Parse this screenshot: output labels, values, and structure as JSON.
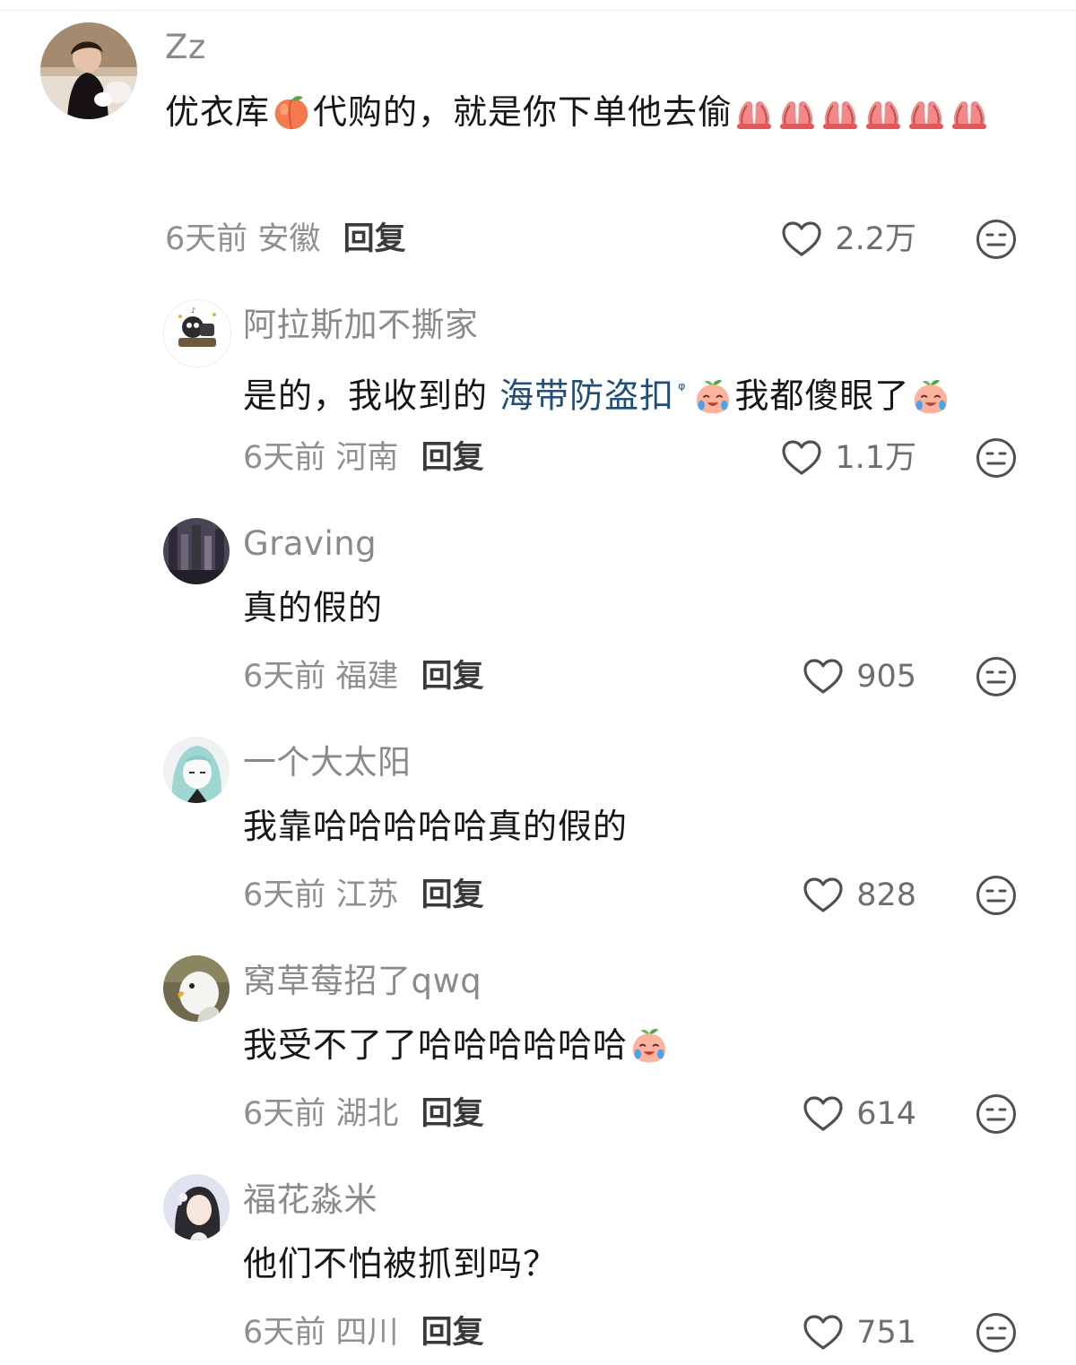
{
  "comments": [
    {
      "user": "Zz",
      "text_parts": [
        "优衣库",
        "代购的，就是你下单他去偷"
      ],
      "time": "6天前",
      "location": "安徽",
      "reply_label": "回复",
      "likes": "2.2万",
      "emoji_names": [
        "peach-emoji",
        "pray-emoji"
      ]
    },
    {
      "user": "阿拉斯加不撕家",
      "text_parts": [
        "是的，我收到的 ",
        "海带防盗扣",
        "我都傻眼了"
      ],
      "search_glyph": "ᵠ",
      "time": "6天前",
      "location": "河南",
      "reply_label": "回复",
      "likes": "1.1万",
      "emoji_names": [
        "crying-peach-emoji"
      ]
    },
    {
      "user": "Graving",
      "text": "真的假的",
      "time": "6天前",
      "location": "福建",
      "reply_label": "回复",
      "likes": "905"
    },
    {
      "user": "一个大太阳",
      "text": "我靠哈哈哈哈哈真的假的",
      "time": "6天前",
      "location": "江苏",
      "reply_label": "回复",
      "likes": "828"
    },
    {
      "user": "窝草莓招了qwq",
      "text": "我受不了了哈哈哈哈哈哈",
      "time": "6天前",
      "location": "湖北",
      "reply_label": "回复",
      "likes": "614",
      "emoji_names": [
        "crying-peach-emoji"
      ]
    },
    {
      "user": "福花淼米",
      "text": "他们不怕被抓到吗？",
      "time": "6天前",
      "location": "四川",
      "reply_label": "回复",
      "likes": "751"
    }
  ],
  "icons": {
    "like": "heart-outline-icon",
    "dislike": "neutral-face-icon"
  },
  "colors": {
    "username": "#8a8a8a",
    "link": "#1f4e7a",
    "meta": "#8f8f8f",
    "reply": "#3a3a3a"
  }
}
